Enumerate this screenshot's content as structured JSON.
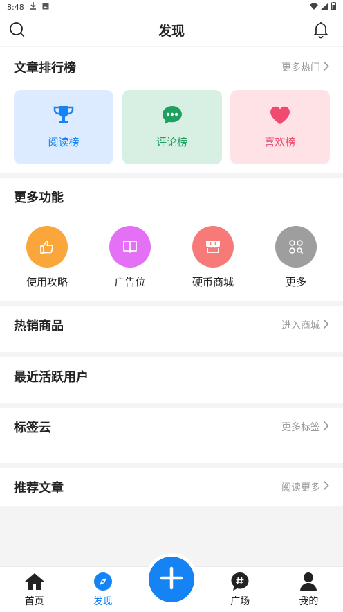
{
  "status_bar": {
    "time": "8:48"
  },
  "header": {
    "title": "发现"
  },
  "ranking": {
    "title": "文章排行榜",
    "more": "更多热门",
    "cards": [
      {
        "label": "阅读榜",
        "icon": "trophy-icon",
        "bg": "#dcebff",
        "color": "#1683f5"
      },
      {
        "label": "评论榜",
        "icon": "comment-icon",
        "bg": "#d8efe4",
        "color": "#20a060"
      },
      {
        "label": "喜欢榜",
        "icon": "heart-icon",
        "bg": "#ffe2e6",
        "color": "#f04b6f"
      }
    ]
  },
  "functions": {
    "title": "更多功能",
    "items": [
      {
        "label": "使用攻略",
        "icon": "thumbs-up-icon",
        "color": "#fba63a"
      },
      {
        "label": "广告位",
        "icon": "book-icon",
        "color": "#e370f5"
      },
      {
        "label": "硬币商城",
        "icon": "shop-icon",
        "color": "#f77a78"
      },
      {
        "label": "更多",
        "icon": "apps-icon",
        "color": "#9e9e9e"
      }
    ]
  },
  "hot_products": {
    "title": "热销商品",
    "more": "进入商城"
  },
  "active_users": {
    "title": "最近活跃用户"
  },
  "tag_cloud": {
    "title": "标签云",
    "more": "更多标签"
  },
  "recommended": {
    "title": "推荐文章",
    "more": "阅读更多"
  },
  "tabbar": {
    "items": [
      {
        "label": "首页",
        "icon": "home-icon"
      },
      {
        "label": "发现",
        "icon": "compass-icon",
        "active": true
      },
      {
        "label": "广场",
        "icon": "hashtag-icon"
      },
      {
        "label": "我的",
        "icon": "person-icon"
      }
    ],
    "fab_icon": "plus-icon",
    "accent": "#1683f5"
  }
}
